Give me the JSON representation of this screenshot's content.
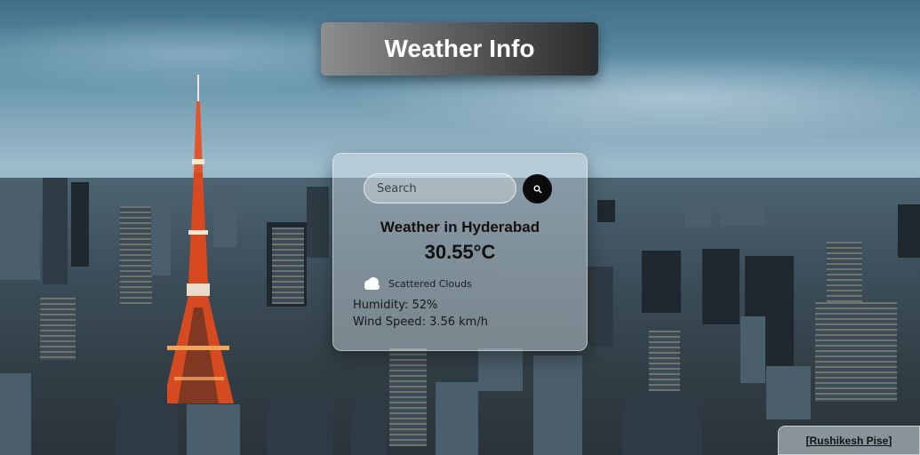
{
  "header": {
    "title": "Weather Info"
  },
  "search": {
    "placeholder": "Search",
    "value": ""
  },
  "weather": {
    "city_heading": "Weather in Hyderabad",
    "temperature": "30.55°C",
    "description": "Scattered Clouds",
    "humidity": "Humidity: 52%",
    "wind_speed": "Wind Speed: 3.56 km/h"
  },
  "footer": {
    "credit": "[Rushikesh Pise]"
  },
  "icons": {
    "search": "search-icon",
    "weather": "cloud-icon"
  },
  "colors": {
    "tower_orange": "#e2552a",
    "title_text": "#ffffff",
    "search_button": "#0b0b0b"
  }
}
